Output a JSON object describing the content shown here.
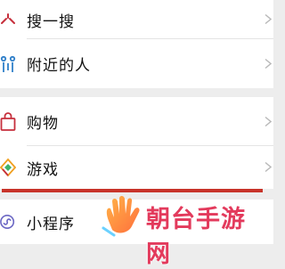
{
  "menu": {
    "items": [
      {
        "label": "搜一搜",
        "icon": "search-burst-icon"
      },
      {
        "label": "附近的人",
        "icon": "people-icon"
      },
      {
        "label": "购物",
        "icon": "shopping-bag-icon"
      },
      {
        "label": "游戏",
        "icon": "game-diamond-icon"
      },
      {
        "label": "小程序",
        "icon": "mini-program-icon"
      }
    ]
  },
  "watermark": {
    "text": "朝台手游网"
  },
  "colors": {
    "accent_red": "#c8342a",
    "watermark_pink": "#e33a5c"
  }
}
